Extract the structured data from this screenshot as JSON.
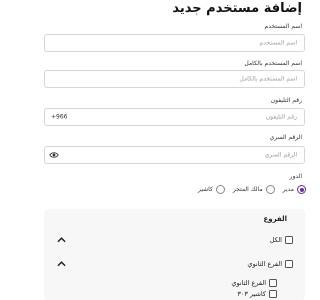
{
  "form": {
    "title": "إضافة مستخدم جديد",
    "username": {
      "label": "اسم المستخدم",
      "placeholder": "اسم المستخدم"
    },
    "fullname": {
      "label": "اسم المستخدم بالكامل",
      "placeholder": "اسم المستخدم بالكامل"
    },
    "phone": {
      "label": "رقم التليفون",
      "placeholder": "رقم التليفون",
      "prefix": "+966"
    },
    "password": {
      "label": "الرقم السري",
      "placeholder": "الرقم السري",
      "toggle_icon": "eye-icon"
    },
    "role": {
      "label": "الدور",
      "options": [
        {
          "label": "مدير",
          "selected": true
        },
        {
          "label": "مالك المتجر",
          "selected": false
        },
        {
          "label": "كاشير",
          "selected": false
        }
      ]
    }
  },
  "branches": {
    "title": "الفروع",
    "all_label": "الكل",
    "groups": [
      {
        "label": "الفرع الثانوي",
        "expanded": true
      },
      {
        "label": "الفرع الثانوي"
      },
      {
        "label": "كاشير ٣٠٣"
      }
    ]
  },
  "colors": {
    "accent": "#6a2ba6",
    "border": "#d6d6d6",
    "panel": "#f7f7f8"
  }
}
